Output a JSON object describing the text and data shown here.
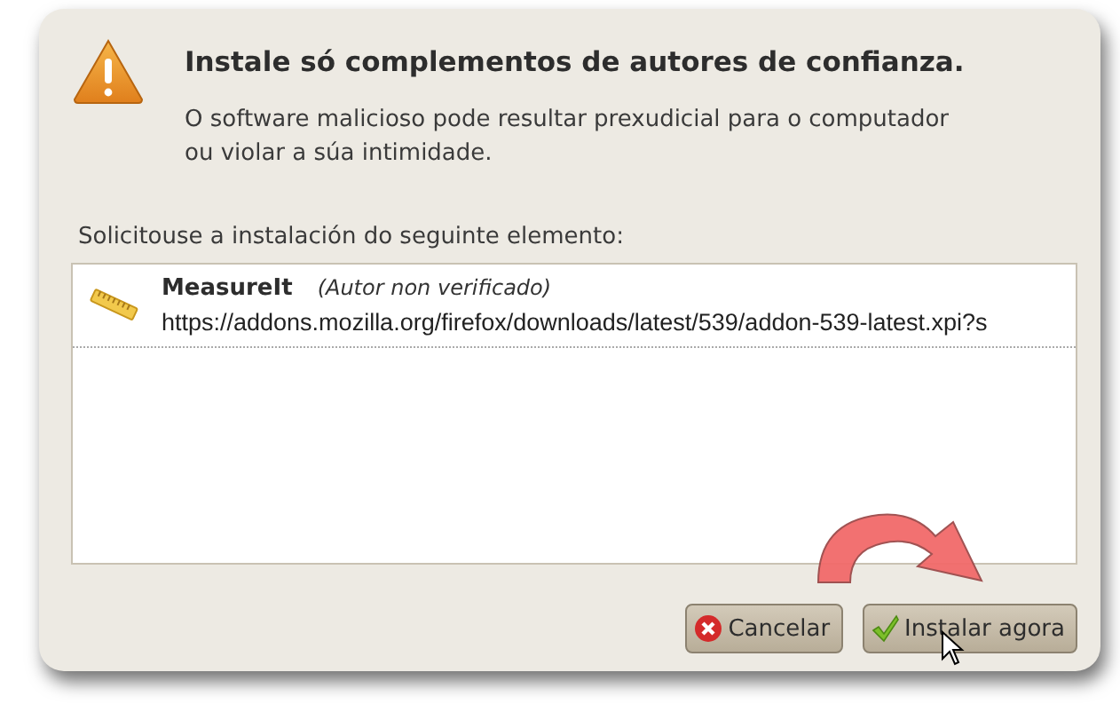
{
  "dialog": {
    "heading": "Instale só complementos de autores de confianza.",
    "message": "O software malicioso pode resultar prexudicial para o computador ou violar a súa intimidade.",
    "list_label": "Solicitouse a instalación do seguinte elemento:"
  },
  "items": [
    {
      "name": "MeasureIt",
      "author_note": "(Autor non verificado)",
      "url": "https://addons.mozilla.org/firefox/downloads/latest/539/addon-539-latest.xpi?s"
    }
  ],
  "buttons": [
    {
      "kind": "cancel",
      "label": "Cancelar"
    },
    {
      "kind": "confirm",
      "label": "Instalar agora"
    }
  ]
}
